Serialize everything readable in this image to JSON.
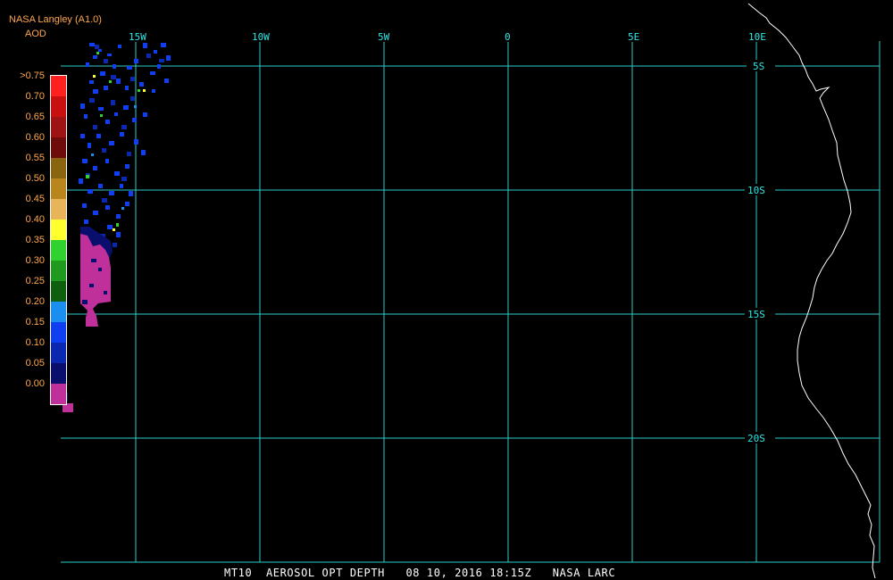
{
  "header": {
    "org": "NASA Langley (A1.0)",
    "variable": "AOD"
  },
  "legend": {
    "labels": [
      ">0.75",
      "0.70",
      "0.65",
      "0.60",
      "0.55",
      "0.50",
      "0.45",
      "0.40",
      "0.35",
      "0.30",
      "0.25",
      "0.20",
      "0.15",
      "0.10",
      "0.05",
      "0.00"
    ],
    "colors": [
      "#ff2020",
      "#c81010",
      "#9e1414",
      "#6e0c0c",
      "#8a6510",
      "#b8861c",
      "#e8b45a",
      "#ffff30",
      "#30d230",
      "#1f9a1f",
      "#0f5f0f",
      "#1a8ff0",
      "#0f3ff0",
      "#0a28b0",
      "#0a0f6e",
      "#c0309a"
    ]
  },
  "map": {
    "longitudes": [
      "15W",
      "10W",
      "5W",
      "0",
      "5E",
      "10E"
    ],
    "latitudes": [
      "5S",
      "10S",
      "15S",
      "20S"
    ],
    "aerosol_colors": {
      "low": "#c0309a",
      "very_low": "#0a0f6e",
      "dark_blue": "#0f3ff0",
      "green": "#30d230",
      "yellow": "#ffff30"
    }
  },
  "footer": {
    "text": "MT10  AEROSOL OPT DEPTH   08 10, 2016 18:15Z   NASA LARC"
  }
}
